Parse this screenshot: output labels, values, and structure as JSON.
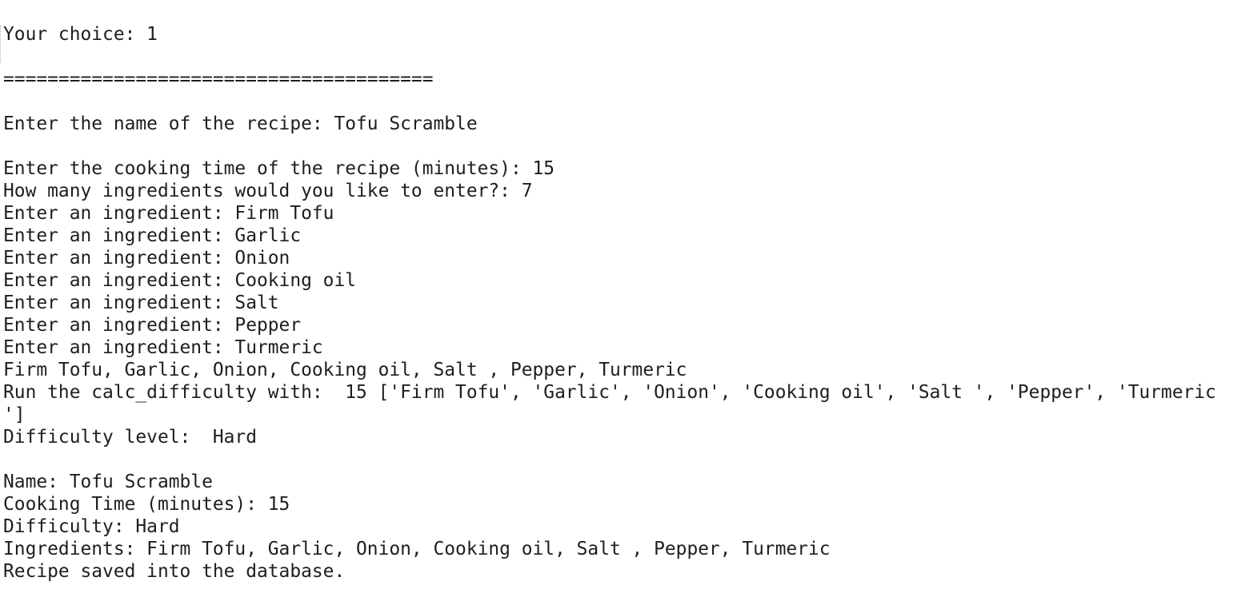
{
  "terminal": {
    "lines": [
      "Your choice: 1",
      "",
      "=======================================",
      "",
      "Enter the name of the recipe: Tofu Scramble",
      "",
      "Enter the cooking time of the recipe (minutes): 15",
      "How many ingredients would you like to enter?: 7",
      "Enter an ingredient: Firm Tofu",
      "Enter an ingredient: Garlic",
      "Enter an ingredient: Onion",
      "Enter an ingredient: Cooking oil",
      "Enter an ingredient: Salt",
      "Enter an ingredient: Pepper",
      "Enter an ingredient: Turmeric",
      "Firm Tofu, Garlic, Onion, Cooking oil, Salt , Pepper, Turmeric",
      "Run the calc_difficulty with:  15 ['Firm Tofu', 'Garlic', 'Onion', 'Cooking oil', 'Salt ', 'Pepper', 'Turmeric",
      "']",
      "Difficulty level:  Hard",
      "",
      "Name: Tofu Scramble",
      "Cooking Time (minutes): 15",
      "Difficulty: Hard",
      "Ingredients: Firm Tofu, Garlic, Onion, Cooking oil, Salt , Pepper, Turmeric",
      "Recipe saved into the database."
    ]
  }
}
